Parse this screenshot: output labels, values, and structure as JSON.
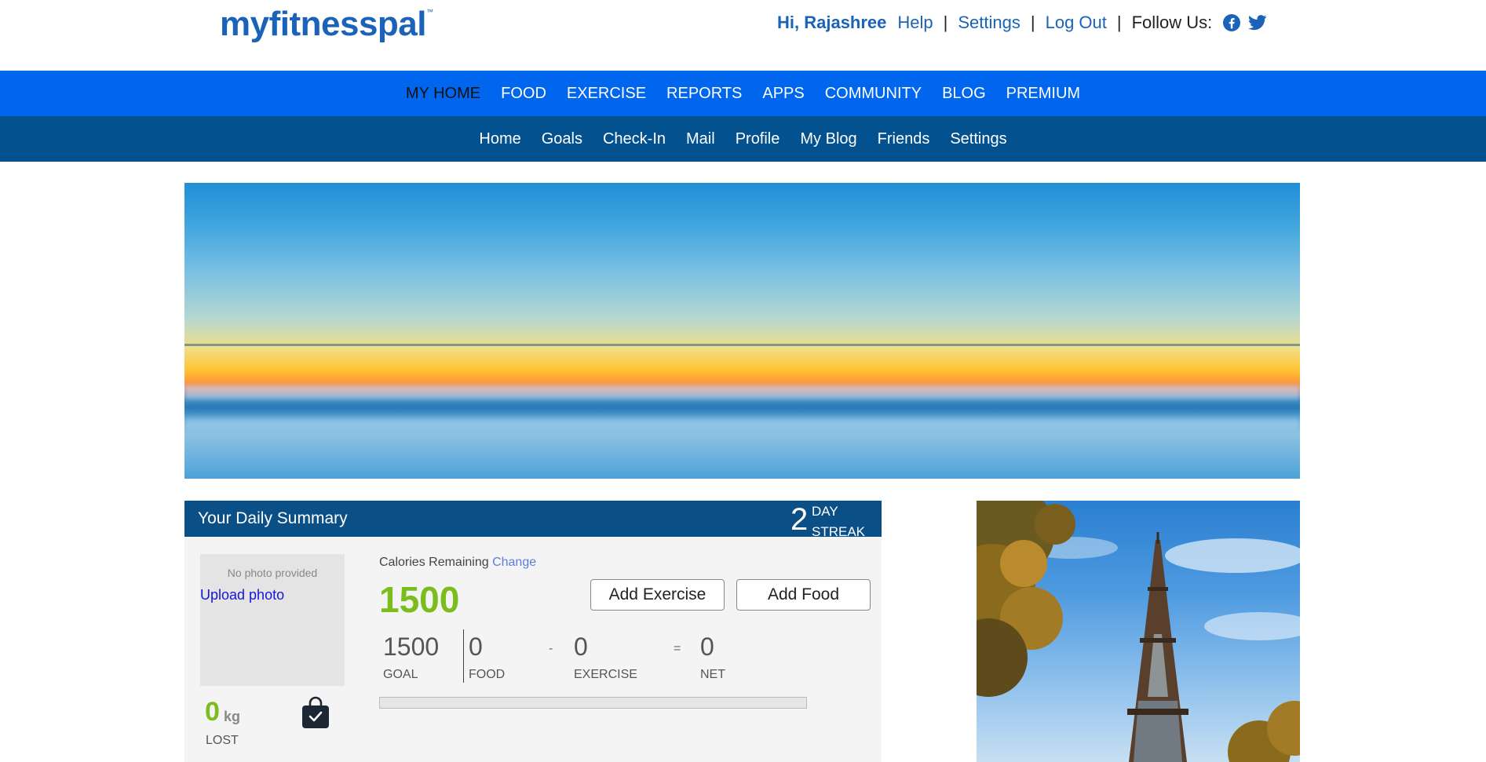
{
  "brand": {
    "logo_text": "myfitnesspal",
    "logo_mark": "™"
  },
  "toplinks": {
    "greeting": "Hi, Rajashree",
    "help": "Help",
    "settings": "Settings",
    "logout": "Log Out",
    "follow": "Follow Us:",
    "sep": "|"
  },
  "nav_main": [
    "MY HOME",
    "FOOD",
    "EXERCISE",
    "REPORTS",
    "APPS",
    "COMMUNITY",
    "BLOG",
    "PREMIUM"
  ],
  "nav_sub": [
    "Home",
    "Goals",
    "Check-In",
    "Mail",
    "Profile",
    "My Blog",
    "Friends",
    "Settings"
  ],
  "summary": {
    "title": "Your Daily Summary",
    "streak_num": "2",
    "streak_day": "DAY",
    "streak_word": "STREAK",
    "no_photo": "No photo provided",
    "upload": "Upload photo",
    "lost_value": "0",
    "lost_unit": "kg",
    "lost_label": "LOST",
    "calories_label": "Calories Remaining",
    "change": "Change",
    "calories_remaining": "1500",
    "add_exercise": "Add Exercise",
    "add_food": "Add Food",
    "goal_value": "1500",
    "goal_label": "GOAL",
    "food_value": "0",
    "food_label": "FOOD",
    "minus": "-",
    "exercise_value": "0",
    "exercise_label": "EXERCISE",
    "equals": "=",
    "net_value": "0",
    "net_label": "NET",
    "progress_fraction": 0
  },
  "colors": {
    "brand_blue": "#1a63b8",
    "nav_main_bg": "#0066ee",
    "nav_sub_bg": "#03518f",
    "summary_head_bg": "#0b4f87",
    "accent_green": "#7bbd1c"
  },
  "icons": {
    "facebook": "facebook-icon",
    "twitter": "twitter-icon",
    "bag": "shopping-bag-check-icon"
  }
}
